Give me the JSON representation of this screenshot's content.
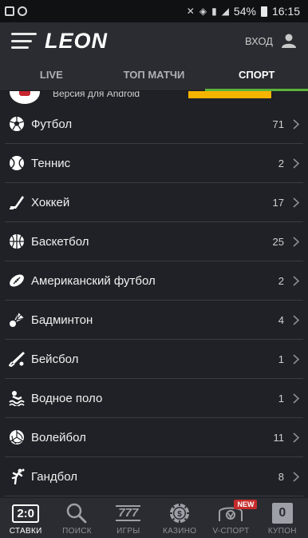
{
  "status_bar": {
    "battery": "54%",
    "time": "16:15"
  },
  "header": {
    "logo": "LEON",
    "login_label": "ВХОД"
  },
  "tabs": [
    {
      "label": "LIVE",
      "active": false
    },
    {
      "label": "ТОП МАТЧИ",
      "active": false
    },
    {
      "label": "СПОРТ",
      "active": true
    }
  ],
  "banner": {
    "text": "Версия для Android"
  },
  "sports": [
    {
      "name": "Футбол",
      "count": "71",
      "icon": "soccer-ball-icon"
    },
    {
      "name": "Теннис",
      "count": "2",
      "icon": "tennis-ball-icon"
    },
    {
      "name": "Хоккей",
      "count": "17",
      "icon": "hockey-stick-icon"
    },
    {
      "name": "Баскетбол",
      "count": "25",
      "icon": "basketball-icon"
    },
    {
      "name": "Американский футбол",
      "count": "2",
      "icon": "american-football-icon"
    },
    {
      "name": "Бадминтон",
      "count": "4",
      "icon": "shuttlecock-icon"
    },
    {
      "name": "Бейсбол",
      "count": "1",
      "icon": "baseball-bat-icon"
    },
    {
      "name": "Водное поло",
      "count": "1",
      "icon": "swimmer-icon"
    },
    {
      "name": "Волейбол",
      "count": "11",
      "icon": "volleyball-icon"
    },
    {
      "name": "Гандбол",
      "count": "8",
      "icon": "handball-player-icon"
    }
  ],
  "bottom_nav": [
    {
      "label": "СТАВКИ",
      "icon": "score-icon",
      "icon_text": "2:0",
      "active": true
    },
    {
      "label": "ПОИСК",
      "icon": "search-icon",
      "active": false
    },
    {
      "label": "ИГРЫ",
      "icon": "slot-icon",
      "icon_text": "777",
      "active": false
    },
    {
      "label": "КАЗИНО",
      "icon": "casino-chip-icon",
      "active": false
    },
    {
      "label": "V-СПОРТ",
      "icon": "vsport-icon",
      "badge": "NEW",
      "active": false
    },
    {
      "label": "КУПОН",
      "icon": "coupon-icon",
      "icon_text": "0",
      "active": false
    }
  ],
  "colors": {
    "background": "#1f2126",
    "header": "#2a2c31",
    "accent_green": "#5bb33b",
    "banner_button": "#f5b400",
    "new_badge": "#c62b2b"
  }
}
